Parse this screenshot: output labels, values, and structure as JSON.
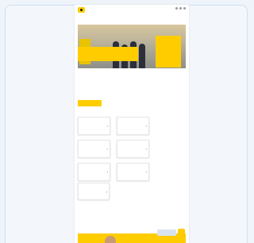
{
  "topbar": {
    "logo_icon": "posthorn-logo-icon",
    "menu_icons": [
      "search-icon",
      "user-icon",
      "menu-icon"
    ]
  },
  "breadcrumb": "",
  "hero": {
    "caption": ""
  },
  "intro": {
    "text": "",
    "button_label": ""
  },
  "tiles": [
    {
      "title": "",
      "desc": ""
    },
    {
      "title": "",
      "desc": ""
    },
    {
      "title": "",
      "desc": ""
    },
    {
      "title": "",
      "desc": ""
    },
    {
      "title": "",
      "desc": ""
    },
    {
      "title": "",
      "desc": ""
    }
  ],
  "wide_tile": {
    "title": ""
  },
  "section": {
    "title": "",
    "text": ""
  },
  "chat": {
    "label": ""
  },
  "colors": {
    "brand": "#ffcc00",
    "background": "#eef4fa"
  }
}
